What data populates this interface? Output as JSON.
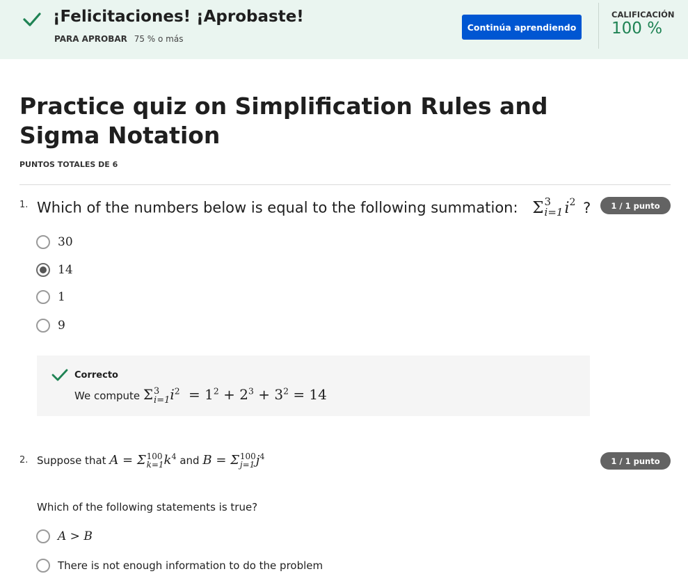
{
  "banner": {
    "title": "¡Felicitaciones! ¡Aprobaste!",
    "pass_label": "PARA APROBAR",
    "pass_value": "75 % o más",
    "continue_label": "Continúa aprendiendo",
    "grade_label": "CALIFICACIÓN",
    "grade_value": "100 %",
    "success_color": "#1f8354",
    "button_color": "#0056d2",
    "icon": "check-icon"
  },
  "quiz": {
    "title": "Practice quiz on Simplification Rules and Sigma Notation",
    "total_points": "PUNTOS TOTALES DE 6"
  },
  "questions": [
    {
      "number": "1.",
      "prompt": "Which of the numbers below is equal to the following summation:",
      "formula": {
        "sigma": "Σ",
        "upper": "3",
        "lower": "i=1",
        "term": "i",
        "exponent": "2",
        "suffix": "?"
      },
      "points": "1 / 1 punto",
      "options": [
        {
          "label": "30",
          "selected": false
        },
        {
          "label": "14",
          "selected": true
        },
        {
          "label": "1",
          "selected": false
        },
        {
          "label": "9",
          "selected": false
        }
      ],
      "feedback": {
        "status": "Correcto",
        "text_prefix": "We compute",
        "formula": "Σ",
        "upper": "3",
        "lower": "i=1",
        "term": "i",
        "term_exp": "2",
        "rhs_a": "= 1",
        "exp_a": "2",
        "rhs_b": "+ 2",
        "exp_b": "3",
        "rhs_c": "+ 3",
        "exp_c": "2",
        "rhs_d": "= 14"
      }
    },
    {
      "number": "2.",
      "prompt_prefix": "Suppose that",
      "a_formula": {
        "lhs": "A = Σ",
        "upper": "100",
        "lower": "k=1",
        "term": "k",
        "exponent": "4"
      },
      "connector": "and",
      "b_formula": {
        "lhs": "B = Σ",
        "upper": "100",
        "lower": "j=1",
        "term": "j",
        "exponent": "4"
      },
      "points": "1 / 1 punto",
      "question": "Which of the following statements is true?",
      "options": [
        {
          "label": "A > B",
          "selected": false
        },
        {
          "label": "There is not enough information to do the problem",
          "selected": false
        }
      ]
    }
  ]
}
